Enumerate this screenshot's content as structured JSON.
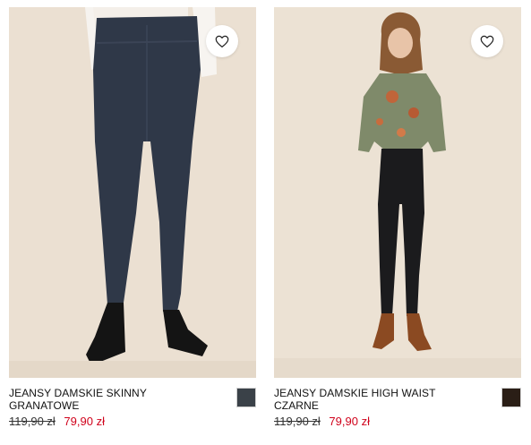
{
  "products": [
    {
      "name": "JEANSY DAMSKIE SKINNY GRANATOWE",
      "old_price": "119,90 zł",
      "new_price": "79,90 zł",
      "photo_bg": "#ebe0d2",
      "jeans_color": "#2f3848",
      "swatch_color": "#3a4148"
    },
    {
      "name": "JEANSY DAMSKIE HIGH WAIST CZARNE",
      "old_price": "119,90 zł",
      "new_price": "79,90 zł",
      "photo_bg": "#ece2d4",
      "jeans_color": "#1b1b1d",
      "swatch_color": "#2a1e16"
    }
  ],
  "icons": {
    "wishlist": "heart-outline-icon"
  },
  "colors": {
    "sale_price": "#d0021b",
    "regular_price": "#333333"
  }
}
